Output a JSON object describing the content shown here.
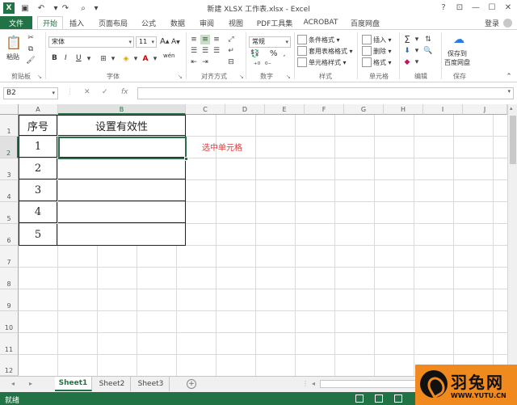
{
  "window": {
    "title": "新建 XLSX 工作表.xlsx - Excel",
    "controls": [
      "?",
      "⊡",
      "—",
      "☐",
      "✕"
    ]
  },
  "ribbon_tabs": {
    "file": "文件",
    "items": [
      "开始",
      "插入",
      "页面布局",
      "公式",
      "数据",
      "审阅",
      "视图",
      "PDF工具集",
      "ACROBAT",
      "百度网盘"
    ],
    "login": "登录"
  },
  "ribbon": {
    "clipboard": {
      "paste": "粘贴",
      "label": "剪贴板"
    },
    "font": {
      "name": "宋体",
      "size": "11",
      "bold": "B",
      "italic": "I",
      "underline": "U",
      "grow": "A",
      "shrink": "A",
      "wen": "wén",
      "label": "字体"
    },
    "alignment": {
      "label": "对齐方式"
    },
    "number": {
      "format": "常规",
      "percent": "%",
      "label": "数字"
    },
    "styles": {
      "conditional": "条件格式",
      "table": "套用表格格式",
      "cell": "单元格样式",
      "label": "样式"
    },
    "cells": {
      "insert": "插入",
      "delete": "删除",
      "format": "格式",
      "label": "单元格"
    },
    "editing": {
      "label": "编辑"
    },
    "save": {
      "btn_line1": "保存到",
      "btn_line2": "百度网盘",
      "label": "保存"
    }
  },
  "formula_bar": {
    "name_box": "B2",
    "cancel": "✕",
    "enter": "✓",
    "fx": "fx",
    "value": ""
  },
  "columns": [
    "A",
    "B",
    "C",
    "D",
    "E",
    "F",
    "G",
    "H",
    "I",
    "J"
  ],
  "rows": [
    "1",
    "2",
    "3",
    "4",
    "5",
    "6",
    "7",
    "8",
    "9",
    "10",
    "11",
    "12"
  ],
  "table": {
    "header_a": "序号",
    "header_b": "设置有效性",
    "numbers": [
      "1",
      "2",
      "3",
      "4",
      "5"
    ]
  },
  "annotation": "选中单元格",
  "sheets": [
    "Sheet1",
    "Sheet2",
    "Sheet3"
  ],
  "status": {
    "text": "就绪"
  },
  "watermark": {
    "cn": "羽兔网",
    "url": "WWW.YUTU.CN"
  },
  "colors": {
    "accent": "#217346",
    "annotation": "#e03a3a",
    "watermark_bg": "#f08a1e"
  }
}
